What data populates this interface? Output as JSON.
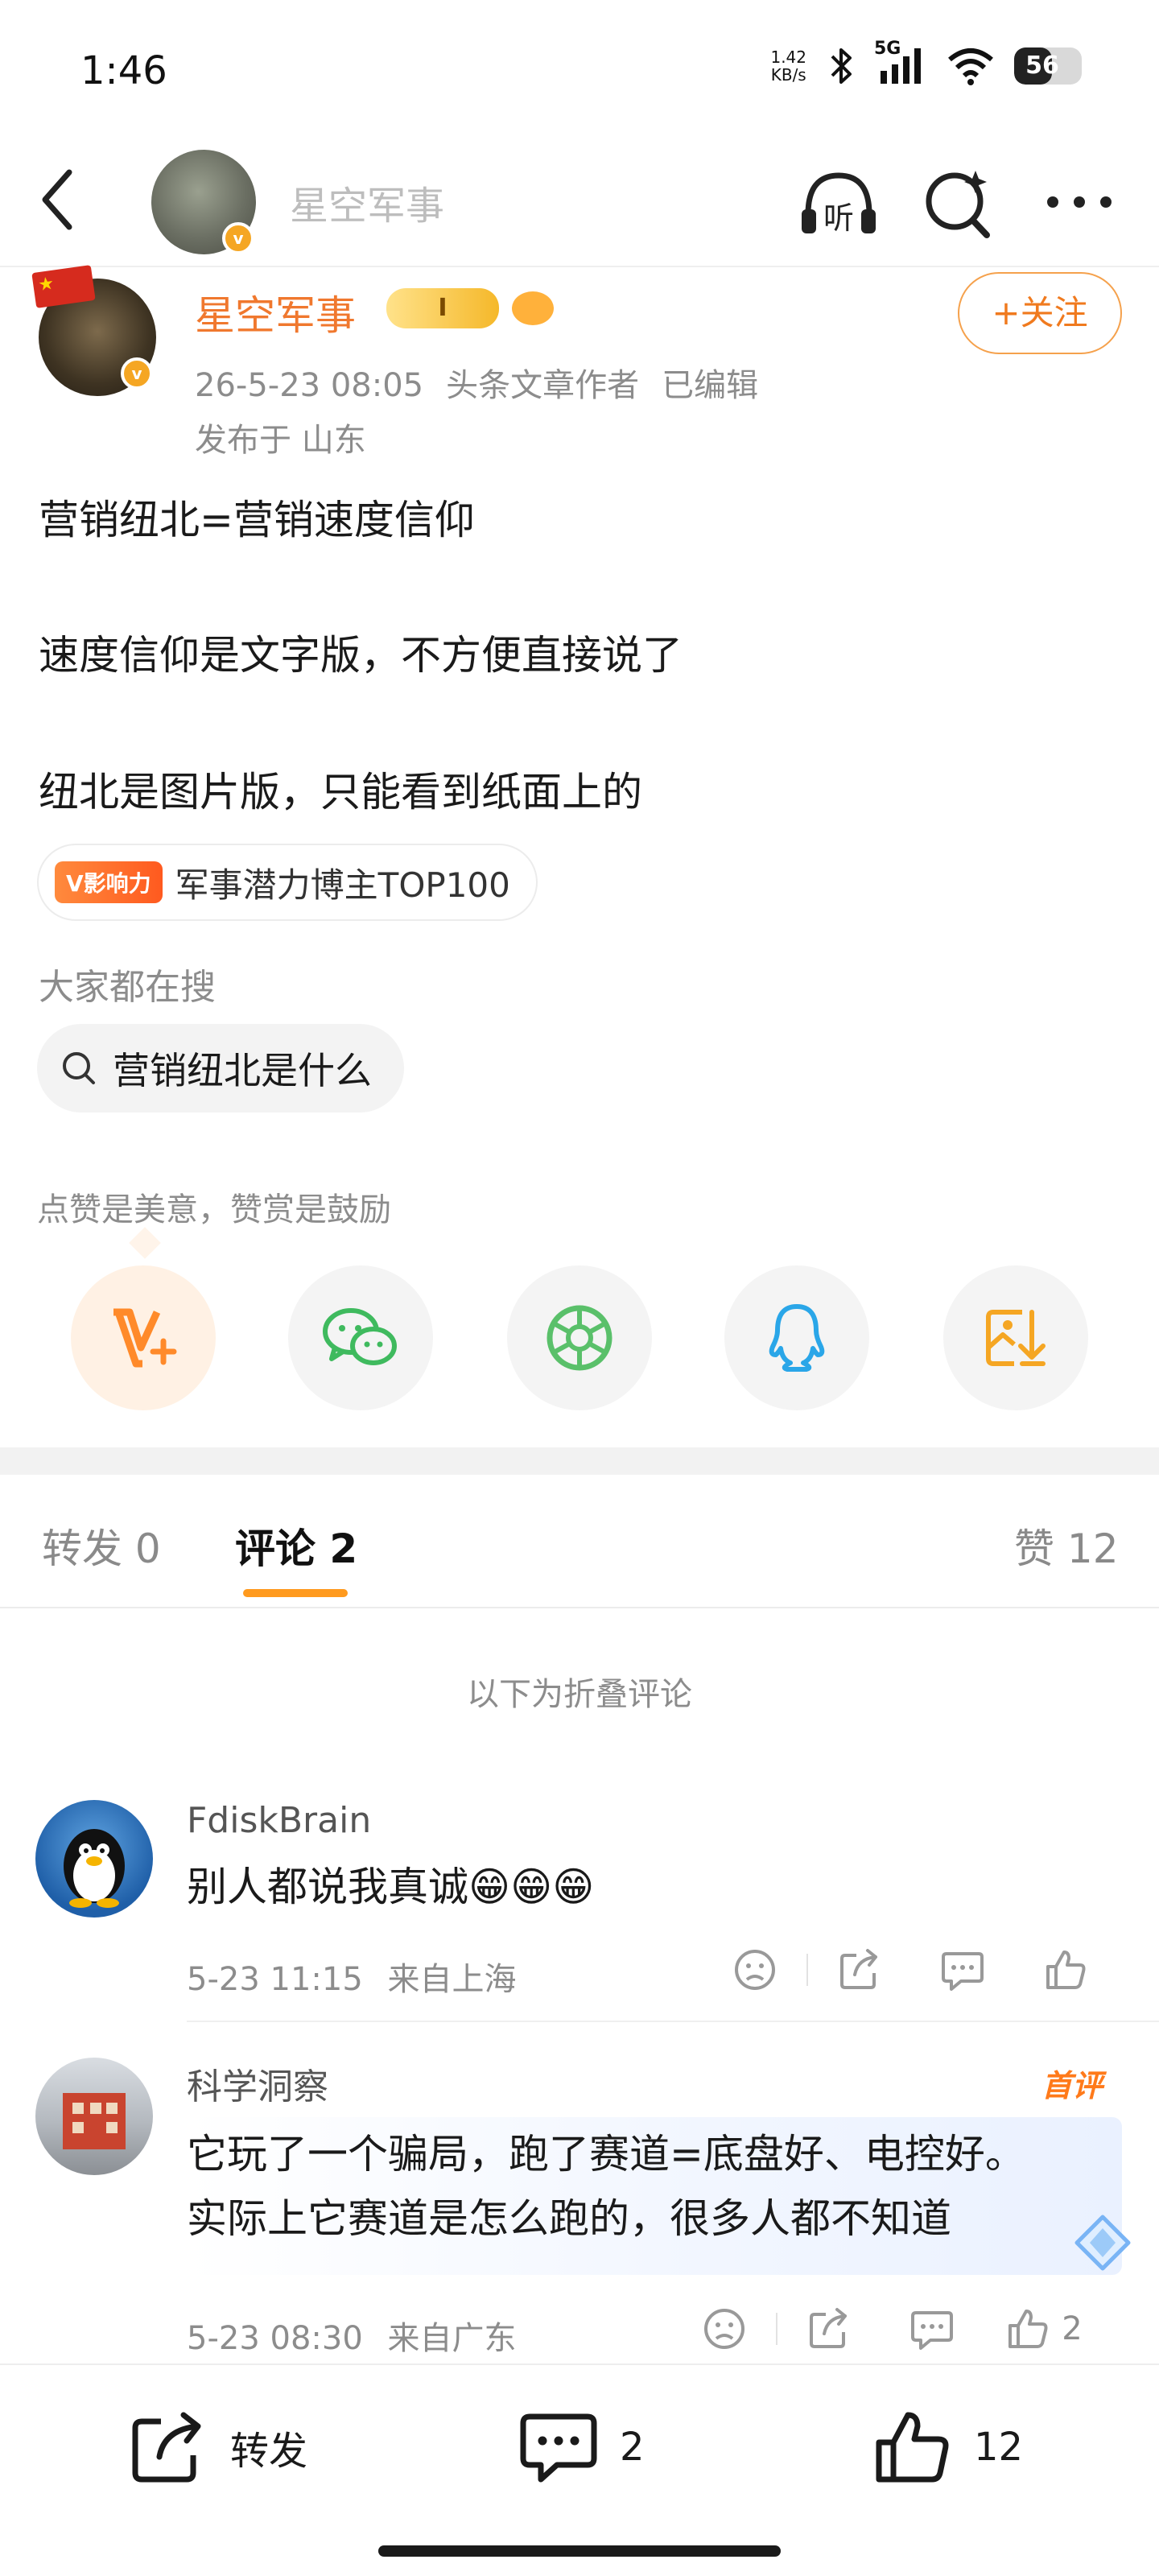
{
  "status_bar": {
    "time": "1:46",
    "net_speed_value": "1.42",
    "net_speed_unit": "KB/s",
    "network": "5G",
    "battery": "56",
    "battery_level": 0.56
  },
  "header": {
    "title": "星空军事"
  },
  "author": {
    "name": "星空军事",
    "vip_badge": "I",
    "date": "26-5-23 08:05",
    "role": "头条文章作者",
    "edited": "已编辑",
    "location": "发布于 山东",
    "follow_label": "+关注"
  },
  "post": {
    "lines": [
      "营销纽北=营销速度信仰",
      "速度信仰是文字版，不方便直接说了",
      "纽北是图片版，只能看到纸面上的"
    ],
    "influence_badge": "V影响力",
    "influence_text": "军事潜力博主TOP100"
  },
  "search": {
    "title": "大家都在搜",
    "query": "营销纽北是什么"
  },
  "reward": {
    "hint": "点赞是美意，赞赏是鼓励"
  },
  "share_icons": [
    "reward-v-icon",
    "wechat-icon",
    "moments-icon",
    "qq-icon",
    "save-image-icon"
  ],
  "tabs": {
    "repost": "转发 0",
    "comment": "评论 2",
    "like": "赞 12"
  },
  "comments": {
    "folded_hint": "以下为折叠评论",
    "items": [
      {
        "name": "FdiskBrain",
        "text": "别人都说我真诚😁😁😁",
        "time": "5-23 11:15",
        "location": "来自上海",
        "likes": ""
      },
      {
        "name": "科学洞察",
        "badge": "首评",
        "text_line1": "它玩了一个骗局，跑了赛道=底盘好、电控好。",
        "text_line2": "实际上它赛道是怎么跑的，很多人都不知道",
        "time": "5-23 08:30",
        "location": "来自广东",
        "likes": "2"
      }
    ]
  },
  "bottom_bar": {
    "repost_label": "转发",
    "comment_count": "2",
    "like_count": "12"
  },
  "colors": {
    "accent": "#f07a1e",
    "tab_underline": "#ff9a1e",
    "wechat_green": "#3fba5e",
    "qq_blue": "#2aa6e8"
  }
}
